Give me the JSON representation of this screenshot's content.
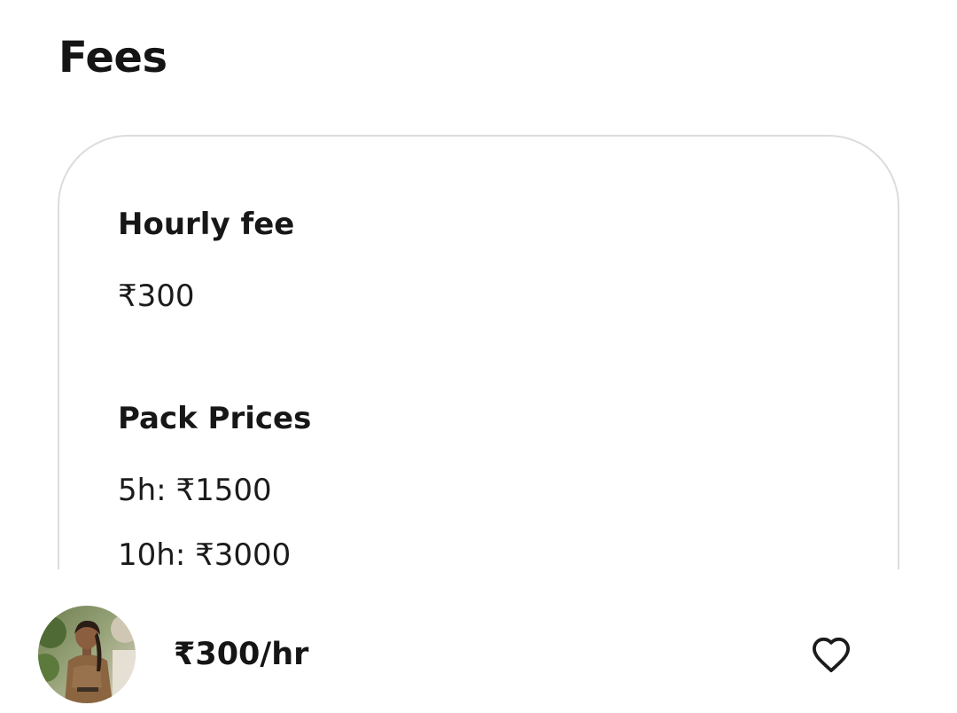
{
  "section": {
    "title": "Fees"
  },
  "fees_card": {
    "hourly_heading": "Hourly fee",
    "hourly_value": "₹300",
    "pack_heading": "Pack Prices",
    "pack_items": [
      "5h: ₹1500",
      "10h: ₹3000"
    ]
  },
  "bottom_bar": {
    "price": "₹300/hr",
    "favorite_icon": "heart-outline-icon",
    "avatar_image": "tutor-profile-photo"
  }
}
